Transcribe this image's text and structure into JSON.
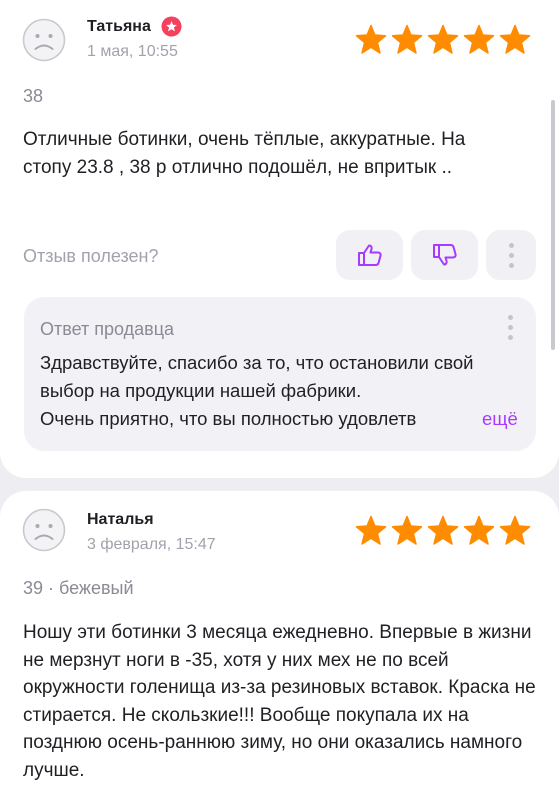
{
  "colors": {
    "star": "#ff8c00",
    "accent": "#a73afd",
    "badge": "#f5405e"
  },
  "reviews": [
    {
      "author": "Татьяна",
      "date": "1 мая, 10:55",
      "rating": 5,
      "meta": "38",
      "text": "Отличные ботинки, очень тёплые, аккуратные. На стопу 23.8  , 38 р отлично подошёл, не впритык ..",
      "helpful_label": "Отзыв полезен?",
      "seller_reply": {
        "title": "Ответ продавца",
        "text": "Здравствуйте, спасибо за то, что остановили свой выбор на продукции нашей фабрики.",
        "last_line": "Очень приятно, что вы полностью удовлетв",
        "more_label": "ещё"
      }
    },
    {
      "author": "Наталья",
      "date": "3 февраля, 15:47",
      "rating": 5,
      "meta": "39 · бежевый",
      "text": "Ношу эти ботинки 3 месяца ежедневно. Впервые в жизни не мерзнут ноги в -35, хотя у них мех не по всей окружности голенища из-за резиновых вставок. Краска не стирается. Не скользкие!!! Вообще покупала их на позднюю осень-раннюю зиму, но они оказались намного лучше."
    }
  ]
}
